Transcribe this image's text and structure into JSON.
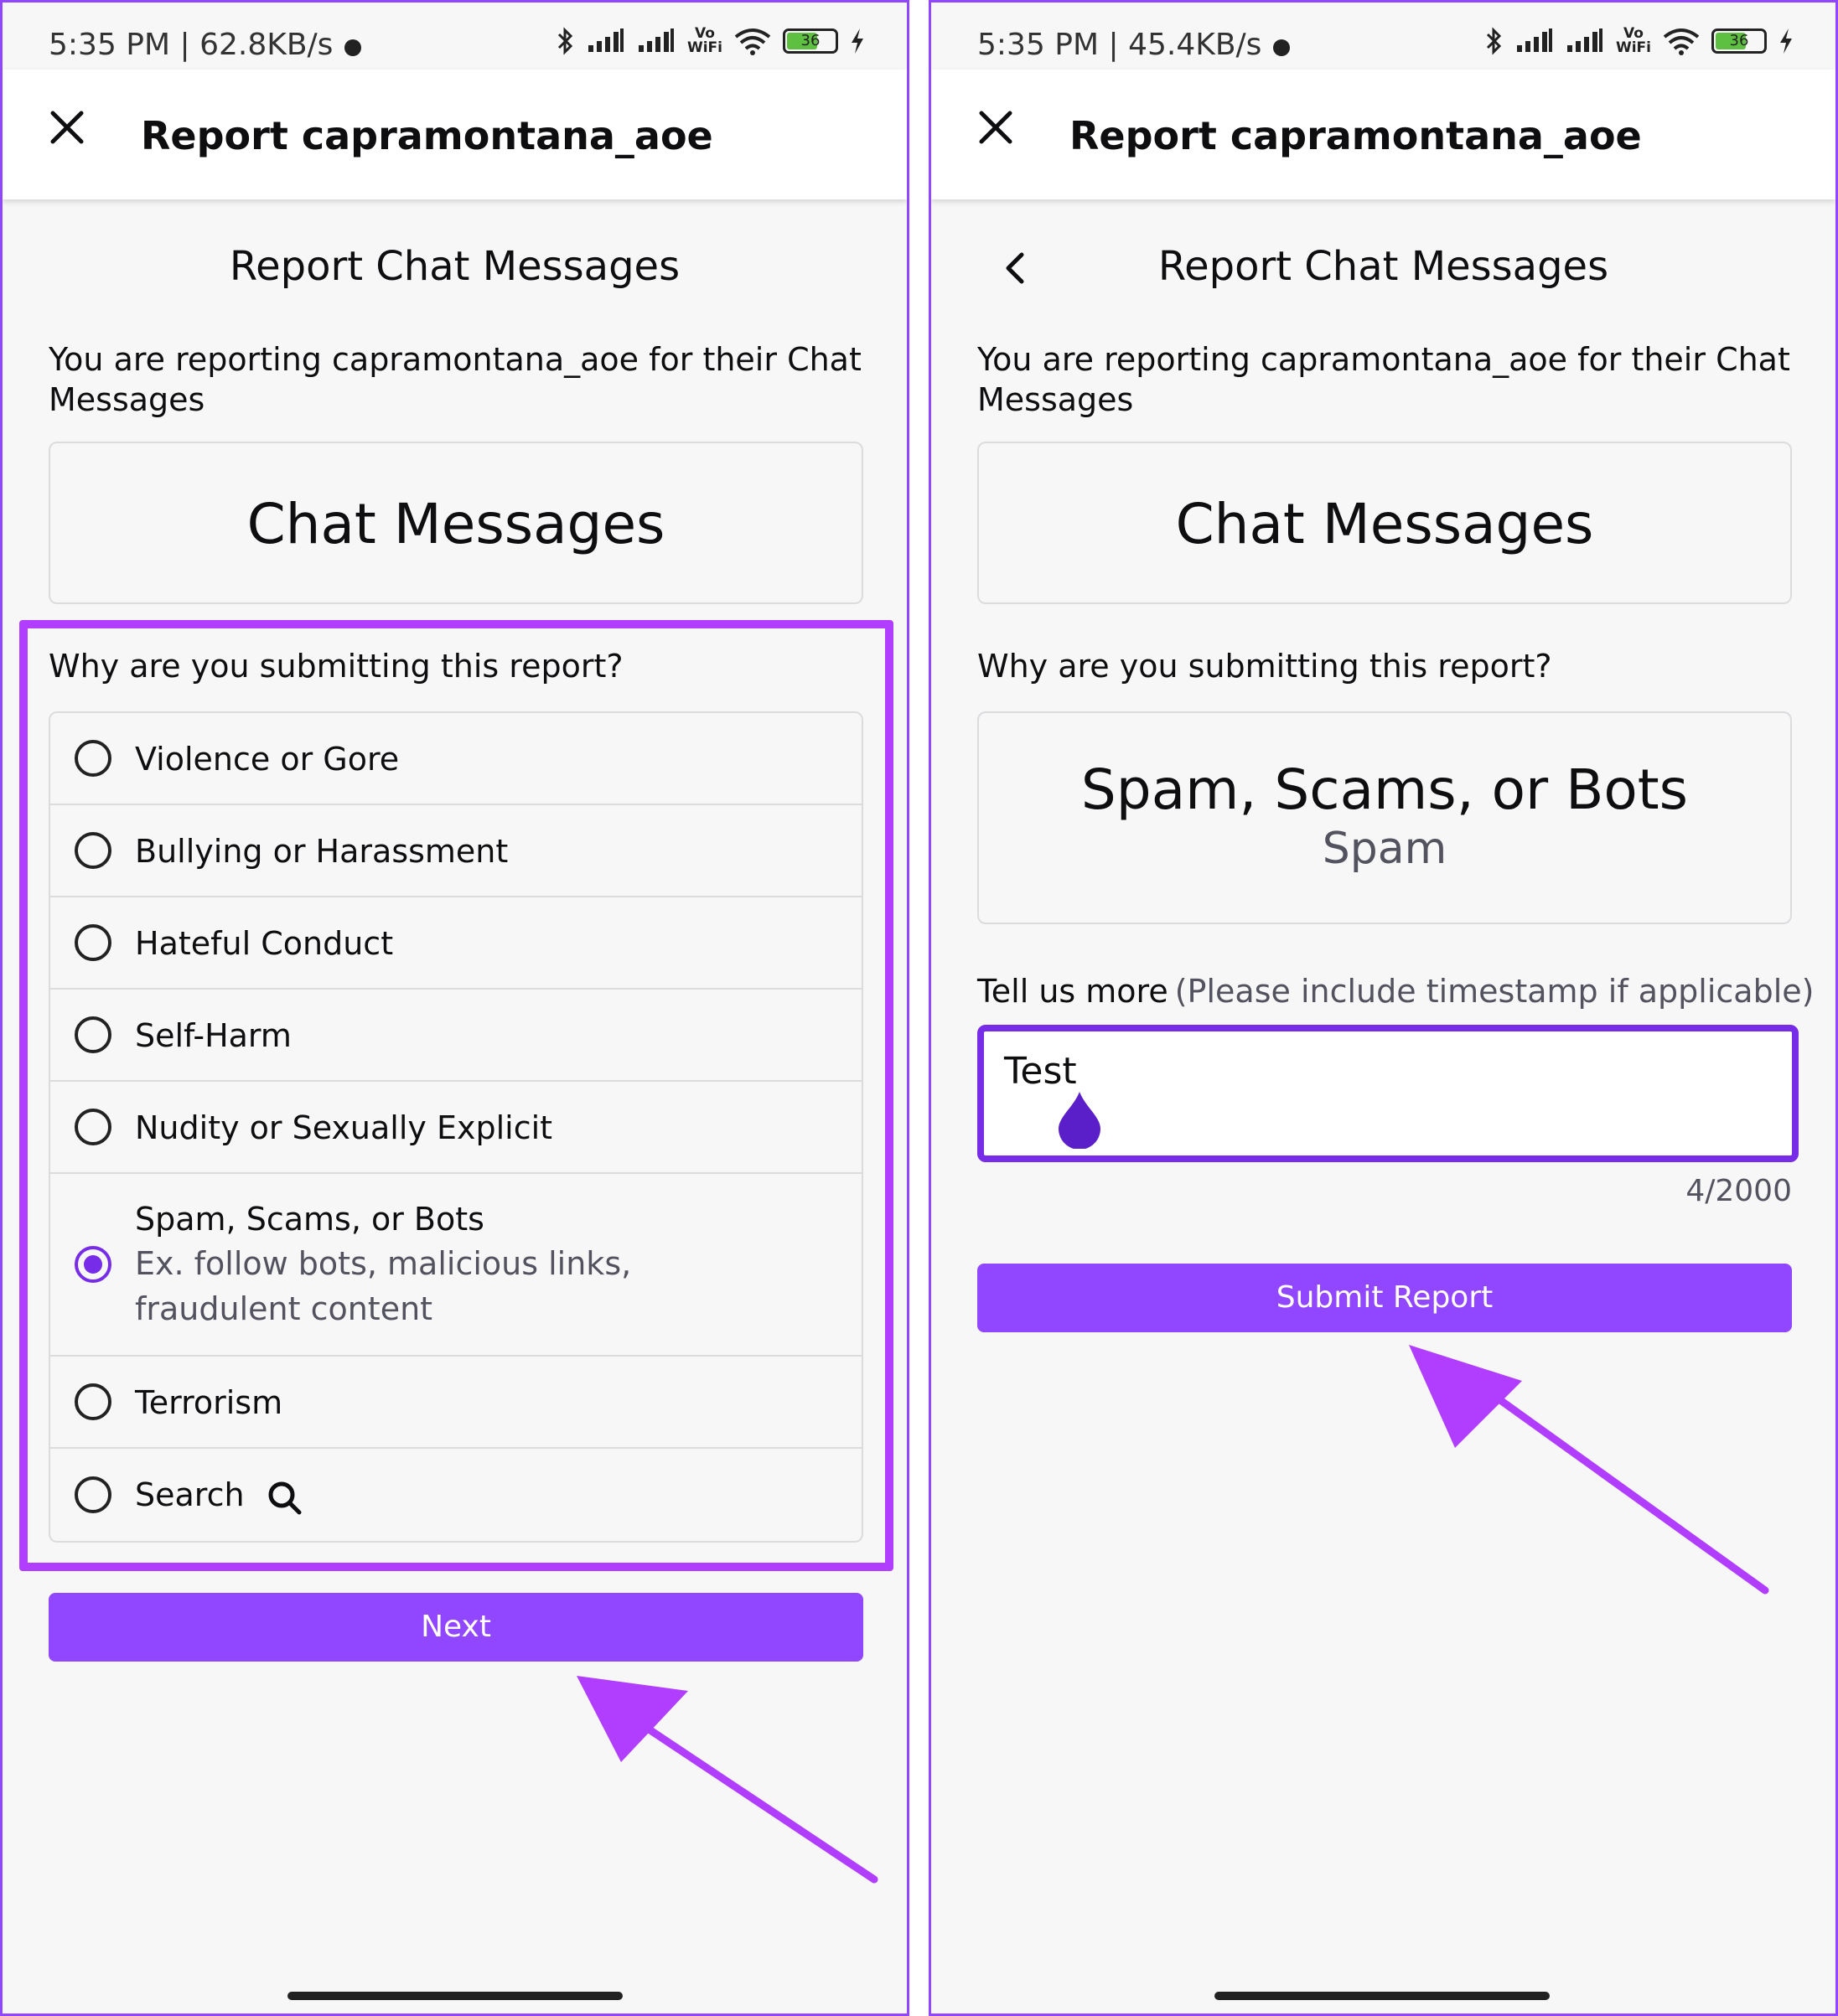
{
  "colors": {
    "accent": "#9147ff",
    "accent_dark": "#772ce8",
    "annotation": "#b13eff",
    "background": "#f7f7f8",
    "text": "#0e0e10",
    "muted": "#53535f"
  },
  "icons": {
    "close": "close-icon",
    "back": "chevron-left-icon",
    "search": "search-icon",
    "bluetooth": "bluetooth-icon",
    "signal": "signal-icon",
    "wifi": "wifi-icon",
    "battery": "battery-icon",
    "charging": "charging-bolt-icon"
  },
  "left": {
    "status": {
      "time": "5:35 PM | 62.8KB/s",
      "vowifi_top": "Vo",
      "vowifi_bottom": "WiFi",
      "battery": "36"
    },
    "header": {
      "title": "Report capramontana_aoe"
    },
    "section_title": "Report Chat Messages",
    "description": "You are reporting capramontana_aoe for their Chat Messages",
    "category": "Chat Messages",
    "question": "Why are you submitting this report?",
    "options": [
      {
        "label": "Violence or Gore",
        "selected": false
      },
      {
        "label": "Bullying or Harassment",
        "selected": false
      },
      {
        "label": "Hateful Conduct",
        "selected": false
      },
      {
        "label": "Self-Harm",
        "selected": false
      },
      {
        "label": "Nudity or Sexually Explicit",
        "selected": false
      },
      {
        "label": "Spam, Scams, or Bots",
        "sub": "Ex. follow bots, malicious links, fraudulent content",
        "selected": true
      },
      {
        "label": "Terrorism",
        "selected": false
      },
      {
        "label": "Search",
        "selected": false
      }
    ],
    "next_button": "Next"
  },
  "right": {
    "status": {
      "time": "5:35 PM | 45.4KB/s",
      "vowifi_top": "Vo",
      "vowifi_bottom": "WiFi",
      "battery": "36"
    },
    "header": {
      "title": "Report capramontana_aoe"
    },
    "section_title": "Report Chat Messages",
    "description": "You are reporting capramontana_aoe for their Chat Messages",
    "category": "Chat Messages",
    "question": "Why are you submitting this report?",
    "selected_reason": {
      "main": "Spam, Scams, or Bots",
      "sub": "Spam"
    },
    "tell_more": {
      "label": "Tell us more",
      "hint": "(Please include timestamp if applicable)"
    },
    "textarea_value": "Test",
    "char_count": "4/2000",
    "submit_button": "Submit Report"
  }
}
